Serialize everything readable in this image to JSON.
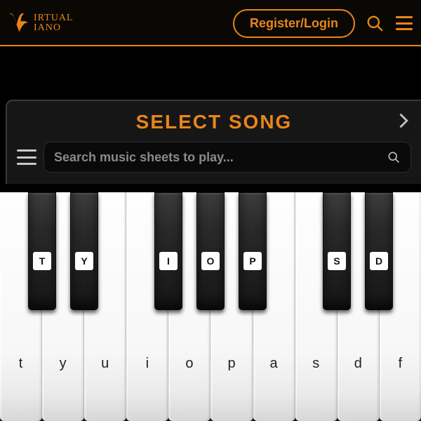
{
  "header": {
    "logo_line1": "IRTUAL",
    "logo_line2": "IANO",
    "register_label": "Register/Login"
  },
  "panel": {
    "title": "SELECT SONG",
    "search_placeholder": "Search music sheets to play..."
  },
  "piano": {
    "white_labels": [
      "t",
      "y",
      "u",
      "i",
      "o",
      "p",
      "a",
      "s",
      "d",
      "f"
    ],
    "black_keys": [
      {
        "pos": 0,
        "label": "T"
      },
      {
        "pos": 1,
        "label": "Y"
      },
      {
        "pos": 3,
        "label": "I"
      },
      {
        "pos": 4,
        "label": "O"
      },
      {
        "pos": 5,
        "label": "P"
      },
      {
        "pos": 7,
        "label": "S"
      },
      {
        "pos": 8,
        "label": "D"
      }
    ]
  },
  "colors": {
    "accent": "#e8851a"
  }
}
